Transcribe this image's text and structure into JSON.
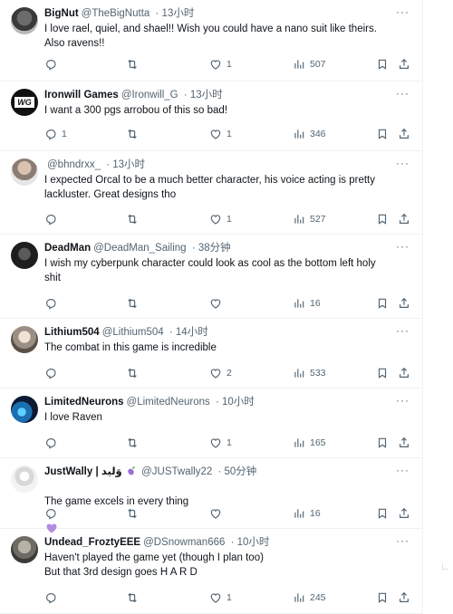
{
  "tweets": [
    {
      "name": "BigNut",
      "handle": "@TheBigNutta",
      "time": "13小时",
      "text": "I love rael, quiel, and shael!! Wish you could have a nano suit like theirs.\nAlso ravens!!",
      "replies": "",
      "retweets": "",
      "likes": "1",
      "views": "507"
    },
    {
      "name": "Ironwill Games",
      "handle": "@Ironwill_G",
      "time": "13小时",
      "text": "I want a 300 pgs arrobou of this so bad!",
      "replies": "1",
      "retweets": "",
      "likes": "1",
      "views": "346"
    },
    {
      "name": "",
      "handle": "@bhndrxx_",
      "time": "13小时",
      "text": "I expected Orcal to be a much better character, his voice acting is pretty\nlackluster. Great designs tho",
      "replies": "",
      "retweets": "",
      "likes": "1",
      "views": "527"
    },
    {
      "name": "DeadMan",
      "handle": "@DeadMan_Sailing",
      "time": "38分钟",
      "text": "I wish my cyberpunk character could look as cool as the bottom left holy\nshit",
      "replies": "",
      "retweets": "",
      "likes": "",
      "views": "16"
    },
    {
      "name": "Lithium504",
      "handle": "@Lithium504",
      "time": "14小时",
      "text": "The combat in this game is incredible",
      "replies": "",
      "retweets": "",
      "likes": "2",
      "views": "533"
    },
    {
      "name": "LimitedNeurons",
      "handle": "@LimitedNeurons",
      "time": "10小时",
      "text": "I love Raven",
      "replies": "",
      "retweets": "",
      "likes": "1",
      "views": "165"
    },
    {
      "name": "JustWally | وَليد",
      "handle": "@JUSTwally22",
      "time": "50分钟",
      "text": "The game excels in every thing",
      "replies": "",
      "retweets": "",
      "likes": "",
      "views": "16"
    },
    {
      "name": "Undead_FroztyEEE",
      "handle": "@DSnowman666",
      "time": "10小时",
      "text": "Haven't played the game yet (though I plan too)\nBut that 3rd design goes H A R D",
      "replies": "",
      "retweets": "",
      "likes": "1",
      "views": "245"
    }
  ],
  "separator": "·",
  "more_glyph": "···",
  "icons": {
    "reply": "reply-icon",
    "retweet": "retweet-icon",
    "like": "heart-icon",
    "views": "views-icon",
    "bookmark": "bookmark-icon",
    "share": "share-icon",
    "emoji_eggplant": "eggplant-icon",
    "emoji_heart": "purple-heart-icon"
  },
  "colors": {
    "text": "#0f1419",
    "muted": "#536471",
    "border": "#eff3f4",
    "accent_purple": "#9b6fd6"
  }
}
